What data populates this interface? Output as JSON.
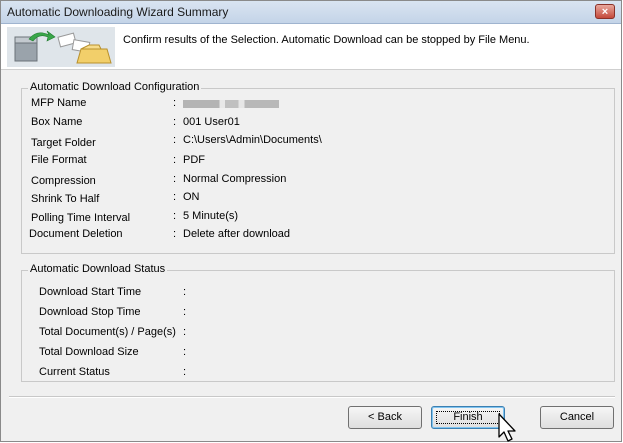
{
  "window": {
    "title": "Automatic Downloading Wizard Summary",
    "close_label": "×"
  },
  "banner": {
    "message": "Confirm results of the Selection. Automatic Download can be stopped by File Menu."
  },
  "config": {
    "title": "Automatic Download Configuration",
    "rows": [
      {
        "label": "MFP Name",
        "colon": ":",
        "value": ""
      },
      {
        "label": "Box Name",
        "colon": ":",
        "value": "001 User01"
      },
      {
        "label": "Target Folder",
        "colon": ":",
        "value": "C:\\Users\\Admin\\Documents\\"
      },
      {
        "label": "File Format",
        "colon": ":",
        "value": "PDF"
      },
      {
        "label": "Compression",
        "colon": ":",
        "value": "Normal Compression"
      },
      {
        "label": "Shrink To Half",
        "colon": ":",
        "value": "ON"
      },
      {
        "label": "Polling Time Interval",
        "colon": ":",
        "value": "5 Minute(s)"
      },
      {
        "label": "Document Deletion",
        "colon": ":",
        "value": "Delete after download"
      }
    ]
  },
  "status": {
    "title": "Automatic Download Status",
    "rows": [
      {
        "label": "Download Start Time",
        "colon": ":"
      },
      {
        "label": "Download Stop Time",
        "colon": ":"
      },
      {
        "label": "Total Document(s) / Page(s)",
        "colon": ":"
      },
      {
        "label": "Total Download Size",
        "colon": ":"
      },
      {
        "label": "Current Status",
        "colon": ":"
      }
    ]
  },
  "buttons": {
    "back": "< Back",
    "finish": "Finish",
    "cancel": "Cancel"
  }
}
